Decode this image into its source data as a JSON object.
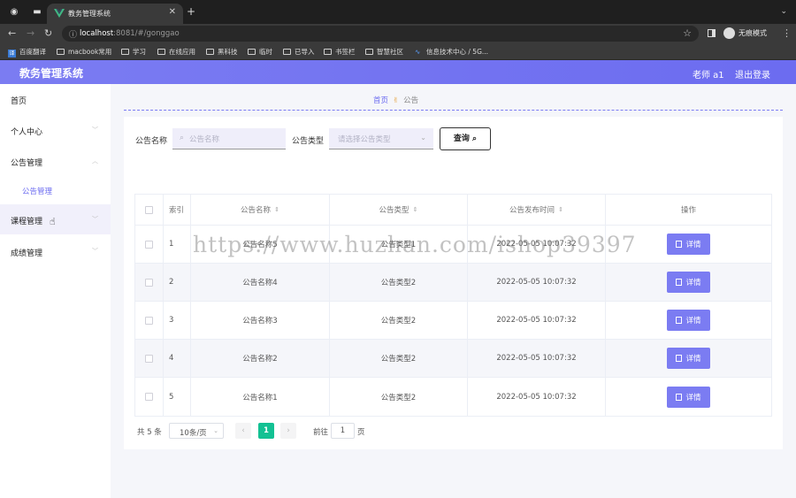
{
  "browser": {
    "tab_title": "教务管理系统",
    "url_host": "localhost",
    "url_path": ":8081/#/gonggao",
    "incognito_label": "无痕模式",
    "bookmarks": [
      {
        "label": "百度翻译",
        "icon": "translate-icon"
      },
      {
        "label": "macbook常用",
        "icon": "folder-icon"
      },
      {
        "label": "学习",
        "icon": "folder-icon"
      },
      {
        "label": "在线应用",
        "icon": "folder-icon"
      },
      {
        "label": "黑科技",
        "icon": "folder-icon"
      },
      {
        "label": "临时",
        "icon": "folder-icon"
      },
      {
        "label": "已导入",
        "icon": "folder-icon"
      },
      {
        "label": "书签栏",
        "icon": "folder-icon"
      },
      {
        "label": "智慧社区",
        "icon": "folder-icon"
      },
      {
        "label": "信息技术中心 / 5G...",
        "icon": "link-icon"
      }
    ]
  },
  "header": {
    "title": "教务管理系统",
    "user": "老师 a1",
    "logout": "退出登录",
    "accent": "#6c6cf0"
  },
  "sidebar": {
    "items": [
      {
        "label": "首页"
      },
      {
        "label": "个人中心"
      },
      {
        "label": "公告管理"
      },
      {
        "label": "课程管理"
      },
      {
        "label": "成绩管理"
      }
    ],
    "sub_item": "公告管理"
  },
  "breadcrumb": {
    "home": "首页",
    "current": "公告"
  },
  "filters": {
    "name_label": "公告名称",
    "name_placeholder": "公告名称",
    "type_label": "公告类型",
    "type_placeholder": "请选择公告类型",
    "search_button": "查询"
  },
  "table": {
    "columns": [
      "索引",
      "公告名称",
      "公告类型",
      "公告发布时间",
      "操作"
    ],
    "detail_button": "详情",
    "rows": [
      {
        "index": "1",
        "name": "公告名称5",
        "type": "公告类型1",
        "time": "2022-05-05 10:07:32"
      },
      {
        "index": "2",
        "name": "公告名称4",
        "type": "公告类型2",
        "time": "2022-05-05 10:07:32"
      },
      {
        "index": "3",
        "name": "公告名称3",
        "type": "公告类型2",
        "time": "2022-05-05 10:07:32"
      },
      {
        "index": "4",
        "name": "公告名称2",
        "type": "公告类型2",
        "time": "2022-05-05 10:07:32"
      },
      {
        "index": "5",
        "name": "公告名称1",
        "type": "公告类型2",
        "time": "2022-05-05 10:07:32"
      }
    ]
  },
  "pagination": {
    "total": "共 5 条",
    "page_size": "10条/页",
    "current_page": "1",
    "goto_label": "前往",
    "goto_value": "1",
    "goto_unit": "页"
  },
  "watermark": "https://www.huzhan.com/ishop39397"
}
